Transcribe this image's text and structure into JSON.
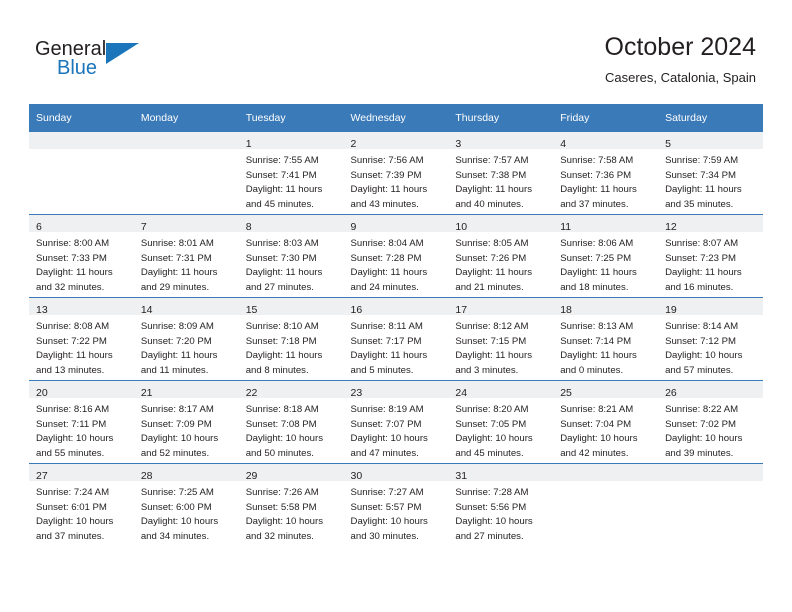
{
  "brand": {
    "name_part1": "General",
    "name_part2": "Blue",
    "triangle_color": "#1b75bb",
    "text_color": "#231f20"
  },
  "header": {
    "title": "October 2024",
    "subtitle": "Caseres, Catalonia, Spain"
  },
  "theme": {
    "header_blue": "#3b7ab8",
    "daynum_band": "#eef0f1",
    "text": "#231f20"
  },
  "weekday_headers": [
    "Sunday",
    "Monday",
    "Tuesday",
    "Wednesday",
    "Thursday",
    "Friday",
    "Saturday"
  ],
  "labels": {
    "sunrise_prefix": "Sunrise:",
    "sunset_prefix": "Sunset:",
    "daylight_prefix": "Daylight:"
  },
  "weeks": [
    [
      {
        "empty": true
      },
      {
        "empty": true
      },
      {
        "day": "1",
        "sunrise": "Sunrise: 7:55 AM",
        "sunset": "Sunset: 7:41 PM",
        "daylight_1": "Daylight: 11 hours",
        "daylight_2": "and 45 minutes."
      },
      {
        "day": "2",
        "sunrise": "Sunrise: 7:56 AM",
        "sunset": "Sunset: 7:39 PM",
        "daylight_1": "Daylight: 11 hours",
        "daylight_2": "and 43 minutes."
      },
      {
        "day": "3",
        "sunrise": "Sunrise: 7:57 AM",
        "sunset": "Sunset: 7:38 PM",
        "daylight_1": "Daylight: 11 hours",
        "daylight_2": "and 40 minutes."
      },
      {
        "day": "4",
        "sunrise": "Sunrise: 7:58 AM",
        "sunset": "Sunset: 7:36 PM",
        "daylight_1": "Daylight: 11 hours",
        "daylight_2": "and 37 minutes."
      },
      {
        "day": "5",
        "sunrise": "Sunrise: 7:59 AM",
        "sunset": "Sunset: 7:34 PM",
        "daylight_1": "Daylight: 11 hours",
        "daylight_2": "and 35 minutes."
      }
    ],
    [
      {
        "day": "6",
        "sunrise": "Sunrise: 8:00 AM",
        "sunset": "Sunset: 7:33 PM",
        "daylight_1": "Daylight: 11 hours",
        "daylight_2": "and 32 minutes."
      },
      {
        "day": "7",
        "sunrise": "Sunrise: 8:01 AM",
        "sunset": "Sunset: 7:31 PM",
        "daylight_1": "Daylight: 11 hours",
        "daylight_2": "and 29 minutes."
      },
      {
        "day": "8",
        "sunrise": "Sunrise: 8:03 AM",
        "sunset": "Sunset: 7:30 PM",
        "daylight_1": "Daylight: 11 hours",
        "daylight_2": "and 27 minutes."
      },
      {
        "day": "9",
        "sunrise": "Sunrise: 8:04 AM",
        "sunset": "Sunset: 7:28 PM",
        "daylight_1": "Daylight: 11 hours",
        "daylight_2": "and 24 minutes."
      },
      {
        "day": "10",
        "sunrise": "Sunrise: 8:05 AM",
        "sunset": "Sunset: 7:26 PM",
        "daylight_1": "Daylight: 11 hours",
        "daylight_2": "and 21 minutes."
      },
      {
        "day": "11",
        "sunrise": "Sunrise: 8:06 AM",
        "sunset": "Sunset: 7:25 PM",
        "daylight_1": "Daylight: 11 hours",
        "daylight_2": "and 18 minutes."
      },
      {
        "day": "12",
        "sunrise": "Sunrise: 8:07 AM",
        "sunset": "Sunset: 7:23 PM",
        "daylight_1": "Daylight: 11 hours",
        "daylight_2": "and 16 minutes."
      }
    ],
    [
      {
        "day": "13",
        "sunrise": "Sunrise: 8:08 AM",
        "sunset": "Sunset: 7:22 PM",
        "daylight_1": "Daylight: 11 hours",
        "daylight_2": "and 13 minutes."
      },
      {
        "day": "14",
        "sunrise": "Sunrise: 8:09 AM",
        "sunset": "Sunset: 7:20 PM",
        "daylight_1": "Daylight: 11 hours",
        "daylight_2": "and 11 minutes."
      },
      {
        "day": "15",
        "sunrise": "Sunrise: 8:10 AM",
        "sunset": "Sunset: 7:18 PM",
        "daylight_1": "Daylight: 11 hours",
        "daylight_2": "and 8 minutes."
      },
      {
        "day": "16",
        "sunrise": "Sunrise: 8:11 AM",
        "sunset": "Sunset: 7:17 PM",
        "daylight_1": "Daylight: 11 hours",
        "daylight_2": "and 5 minutes."
      },
      {
        "day": "17",
        "sunrise": "Sunrise: 8:12 AM",
        "sunset": "Sunset: 7:15 PM",
        "daylight_1": "Daylight: 11 hours",
        "daylight_2": "and 3 minutes."
      },
      {
        "day": "18",
        "sunrise": "Sunrise: 8:13 AM",
        "sunset": "Sunset: 7:14 PM",
        "daylight_1": "Daylight: 11 hours",
        "daylight_2": "and 0 minutes."
      },
      {
        "day": "19",
        "sunrise": "Sunrise: 8:14 AM",
        "sunset": "Sunset: 7:12 PM",
        "daylight_1": "Daylight: 10 hours",
        "daylight_2": "and 57 minutes."
      }
    ],
    [
      {
        "day": "20",
        "sunrise": "Sunrise: 8:16 AM",
        "sunset": "Sunset: 7:11 PM",
        "daylight_1": "Daylight: 10 hours",
        "daylight_2": "and 55 minutes."
      },
      {
        "day": "21",
        "sunrise": "Sunrise: 8:17 AM",
        "sunset": "Sunset: 7:09 PM",
        "daylight_1": "Daylight: 10 hours",
        "daylight_2": "and 52 minutes."
      },
      {
        "day": "22",
        "sunrise": "Sunrise: 8:18 AM",
        "sunset": "Sunset: 7:08 PM",
        "daylight_1": "Daylight: 10 hours",
        "daylight_2": "and 50 minutes."
      },
      {
        "day": "23",
        "sunrise": "Sunrise: 8:19 AM",
        "sunset": "Sunset: 7:07 PM",
        "daylight_1": "Daylight: 10 hours",
        "daylight_2": "and 47 minutes."
      },
      {
        "day": "24",
        "sunrise": "Sunrise: 8:20 AM",
        "sunset": "Sunset: 7:05 PM",
        "daylight_1": "Daylight: 10 hours",
        "daylight_2": "and 45 minutes."
      },
      {
        "day": "25",
        "sunrise": "Sunrise: 8:21 AM",
        "sunset": "Sunset: 7:04 PM",
        "daylight_1": "Daylight: 10 hours",
        "daylight_2": "and 42 minutes."
      },
      {
        "day": "26",
        "sunrise": "Sunrise: 8:22 AM",
        "sunset": "Sunset: 7:02 PM",
        "daylight_1": "Daylight: 10 hours",
        "daylight_2": "and 39 minutes."
      }
    ],
    [
      {
        "day": "27",
        "sunrise": "Sunrise: 7:24 AM",
        "sunset": "Sunset: 6:01 PM",
        "daylight_1": "Daylight: 10 hours",
        "daylight_2": "and 37 minutes."
      },
      {
        "day": "28",
        "sunrise": "Sunrise: 7:25 AM",
        "sunset": "Sunset: 6:00 PM",
        "daylight_1": "Daylight: 10 hours",
        "daylight_2": "and 34 minutes."
      },
      {
        "day": "29",
        "sunrise": "Sunrise: 7:26 AM",
        "sunset": "Sunset: 5:58 PM",
        "daylight_1": "Daylight: 10 hours",
        "daylight_2": "and 32 minutes."
      },
      {
        "day": "30",
        "sunrise": "Sunrise: 7:27 AM",
        "sunset": "Sunset: 5:57 PM",
        "daylight_1": "Daylight: 10 hours",
        "daylight_2": "and 30 minutes."
      },
      {
        "day": "31",
        "sunrise": "Sunrise: 7:28 AM",
        "sunset": "Sunset: 5:56 PM",
        "daylight_1": "Daylight: 10 hours",
        "daylight_2": "and 27 minutes."
      },
      {
        "empty": true
      },
      {
        "empty": true
      }
    ]
  ]
}
